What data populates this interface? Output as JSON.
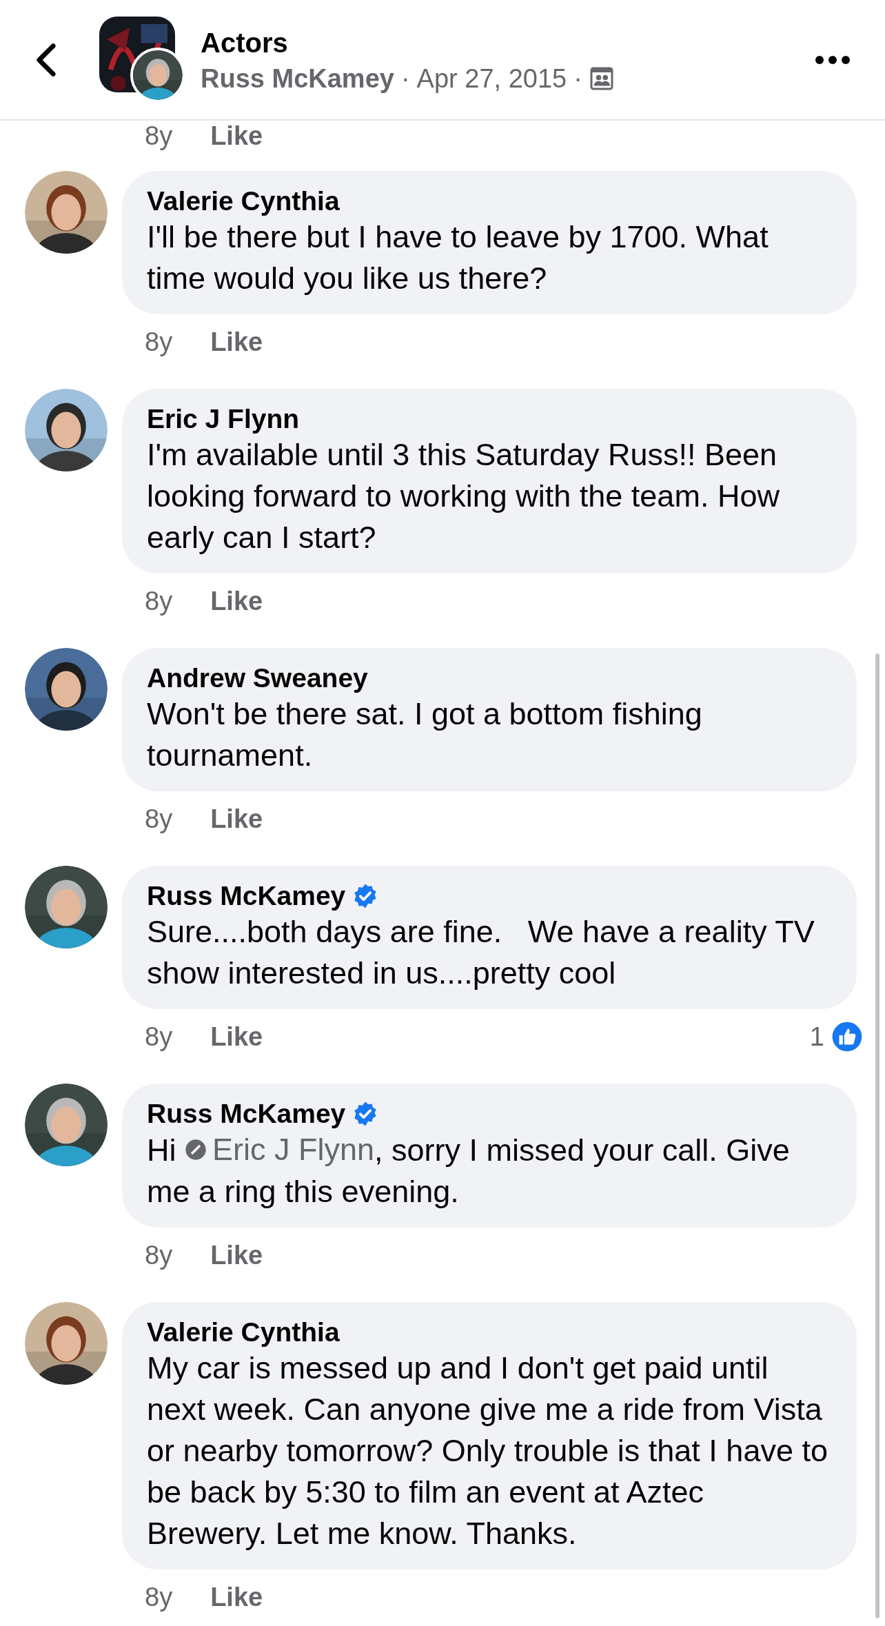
{
  "header": {
    "title": "Actors",
    "author": "Russ McKamey",
    "date": "Apr 27, 2015",
    "separator": "·"
  },
  "previous_meta": {
    "time": "8y",
    "like": "Like"
  },
  "comments": [
    {
      "author": "Valerie Cynthia",
      "verified": false,
      "body": [
        {
          "kind": "text",
          "text": "I'll be there but I have to leave by 1700. What time would you like us there?"
        }
      ],
      "time": "8y",
      "like": "Like"
    },
    {
      "author": "Eric J Flynn",
      "verified": false,
      "body": [
        {
          "kind": "text",
          "text": "I'm available until 3 this Saturday Russ!! Been looking forward to working with the team. How early can I start?"
        }
      ],
      "time": "8y",
      "like": "Like"
    },
    {
      "author": "Andrew Sweaney",
      "verified": false,
      "body": [
        {
          "kind": "text",
          "text": "Won't be there sat. I got a bottom fishing tournament."
        }
      ],
      "time": "8y",
      "like": "Like"
    },
    {
      "author": "Russ McKamey",
      "verified": true,
      "body": [
        {
          "kind": "text",
          "text": "Sure....both days are fine.   We have a reality TV show interested in us....pretty cool"
        }
      ],
      "time": "8y",
      "like": "Like",
      "reactions": "1"
    },
    {
      "author": "Russ McKamey",
      "verified": true,
      "body": [
        {
          "kind": "text",
          "text": "Hi "
        },
        {
          "kind": "mention",
          "text": "Eric J Flynn"
        },
        {
          "kind": "text",
          "text": ", sorry I missed your call. Give me a ring this evening."
        }
      ],
      "time": "8y",
      "like": "Like"
    },
    {
      "author": "Valerie Cynthia",
      "verified": false,
      "body": [
        {
          "kind": "text",
          "text": "My car is messed up and I don't get paid until next week. Can anyone give me a ride from Vista or nearby tomorrow? Only trouble is that I have to be back by 5:30 to film an event at Aztec Brewery. Let me know. Thanks."
        }
      ],
      "time": "8y",
      "like": "Like"
    }
  ]
}
